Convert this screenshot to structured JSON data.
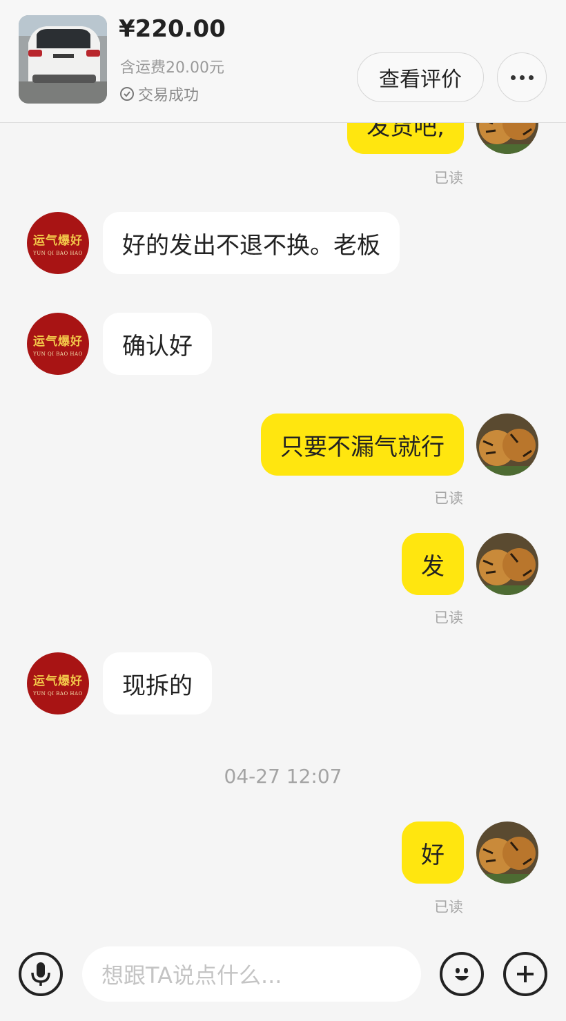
{
  "header": {
    "price": "¥220.00",
    "shipping": "含运费20.00元",
    "status": "交易成功",
    "status_icon": "check-circle-icon",
    "review_button": "查看评价",
    "more_icon": "more-horizontal-icon"
  },
  "messages": [
    {
      "from": "me",
      "text": "发货吧,",
      "read": "已读",
      "partial": true
    },
    {
      "from": "seller",
      "text": "好的发出不退不换。老板"
    },
    {
      "from": "seller",
      "text": "确认好"
    },
    {
      "from": "me",
      "text": "只要不漏气就行",
      "read": "已读"
    },
    {
      "from": "me",
      "text": "发",
      "read": "已读"
    },
    {
      "from": "seller",
      "text": "现拆的"
    },
    {
      "from": "me",
      "text": "好",
      "read": "已读"
    }
  ],
  "timestamp": "04-27 12:07",
  "seller_avatar": {
    "cn": "运气爆好",
    "en": "YUN QI BAO HAO"
  },
  "colors": {
    "my_bubble": "#ffe60f",
    "their_bubble": "#ffffff",
    "seller_avatar_bg": "#a81414"
  },
  "input": {
    "placeholder": "想跟TA说点什么...",
    "voice_icon": "microphone-icon",
    "emoji_icon": "emoji-smile-icon",
    "add_icon": "plus-icon"
  }
}
